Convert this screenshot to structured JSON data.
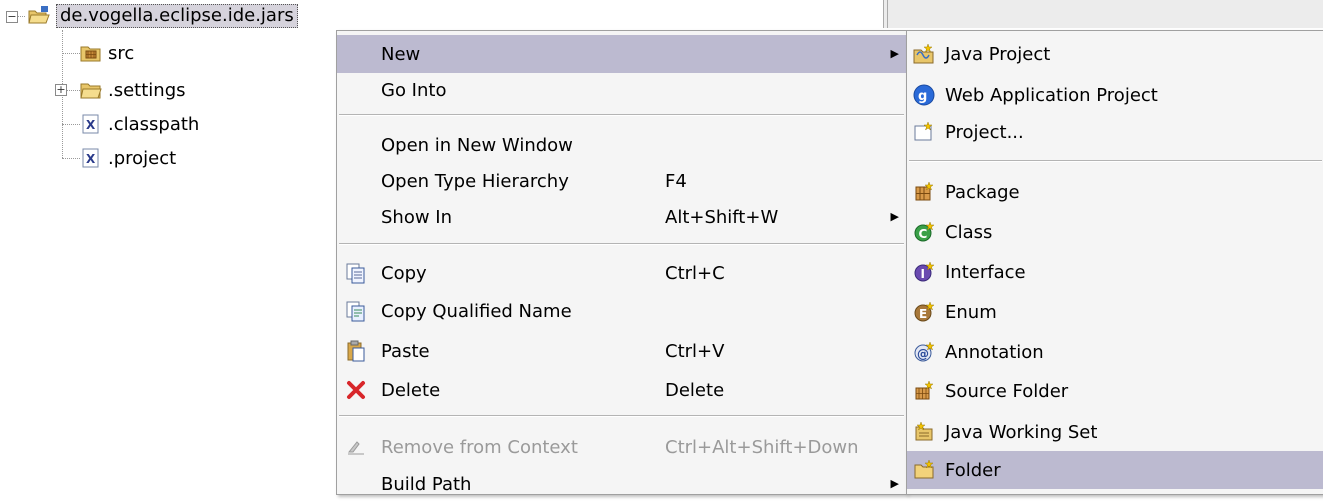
{
  "tree": {
    "root": {
      "label": "de.vogella.eclipse.ide.jars"
    },
    "children": [
      {
        "label": "src"
      },
      {
        "label": ".settings"
      },
      {
        "label": ".classpath"
      },
      {
        "label": ".project"
      }
    ]
  },
  "context_menu": {
    "items": [
      {
        "label": "New",
        "shortcut": ""
      },
      {
        "label": "Go Into",
        "shortcut": ""
      },
      {
        "label": "Open in New Window",
        "shortcut": ""
      },
      {
        "label": "Open Type Hierarchy",
        "shortcut": "F4"
      },
      {
        "label": "Show In",
        "shortcut": "Alt+Shift+W"
      },
      {
        "label": "Copy",
        "shortcut": "Ctrl+C"
      },
      {
        "label": "Copy Qualified Name",
        "shortcut": ""
      },
      {
        "label": "Paste",
        "shortcut": "Ctrl+V"
      },
      {
        "label": "Delete",
        "shortcut": "Delete"
      },
      {
        "label": "Remove from Context",
        "shortcut": "Ctrl+Alt+Shift+Down"
      },
      {
        "label": "Build Path",
        "shortcut": ""
      }
    ]
  },
  "new_submenu": {
    "items": [
      {
        "label": "Java Project"
      },
      {
        "label": "Web Application Project"
      },
      {
        "label": "Project..."
      },
      {
        "label": "Package"
      },
      {
        "label": "Class"
      },
      {
        "label": "Interface"
      },
      {
        "label": "Enum"
      },
      {
        "label": "Annotation"
      },
      {
        "label": "Source Folder"
      },
      {
        "label": "Java Working Set"
      },
      {
        "label": "Folder"
      }
    ]
  },
  "colors": {
    "highlight": "#bcbad0",
    "menu_bg": "#f5f5f5",
    "disabled_text": "#9a9a9a"
  }
}
